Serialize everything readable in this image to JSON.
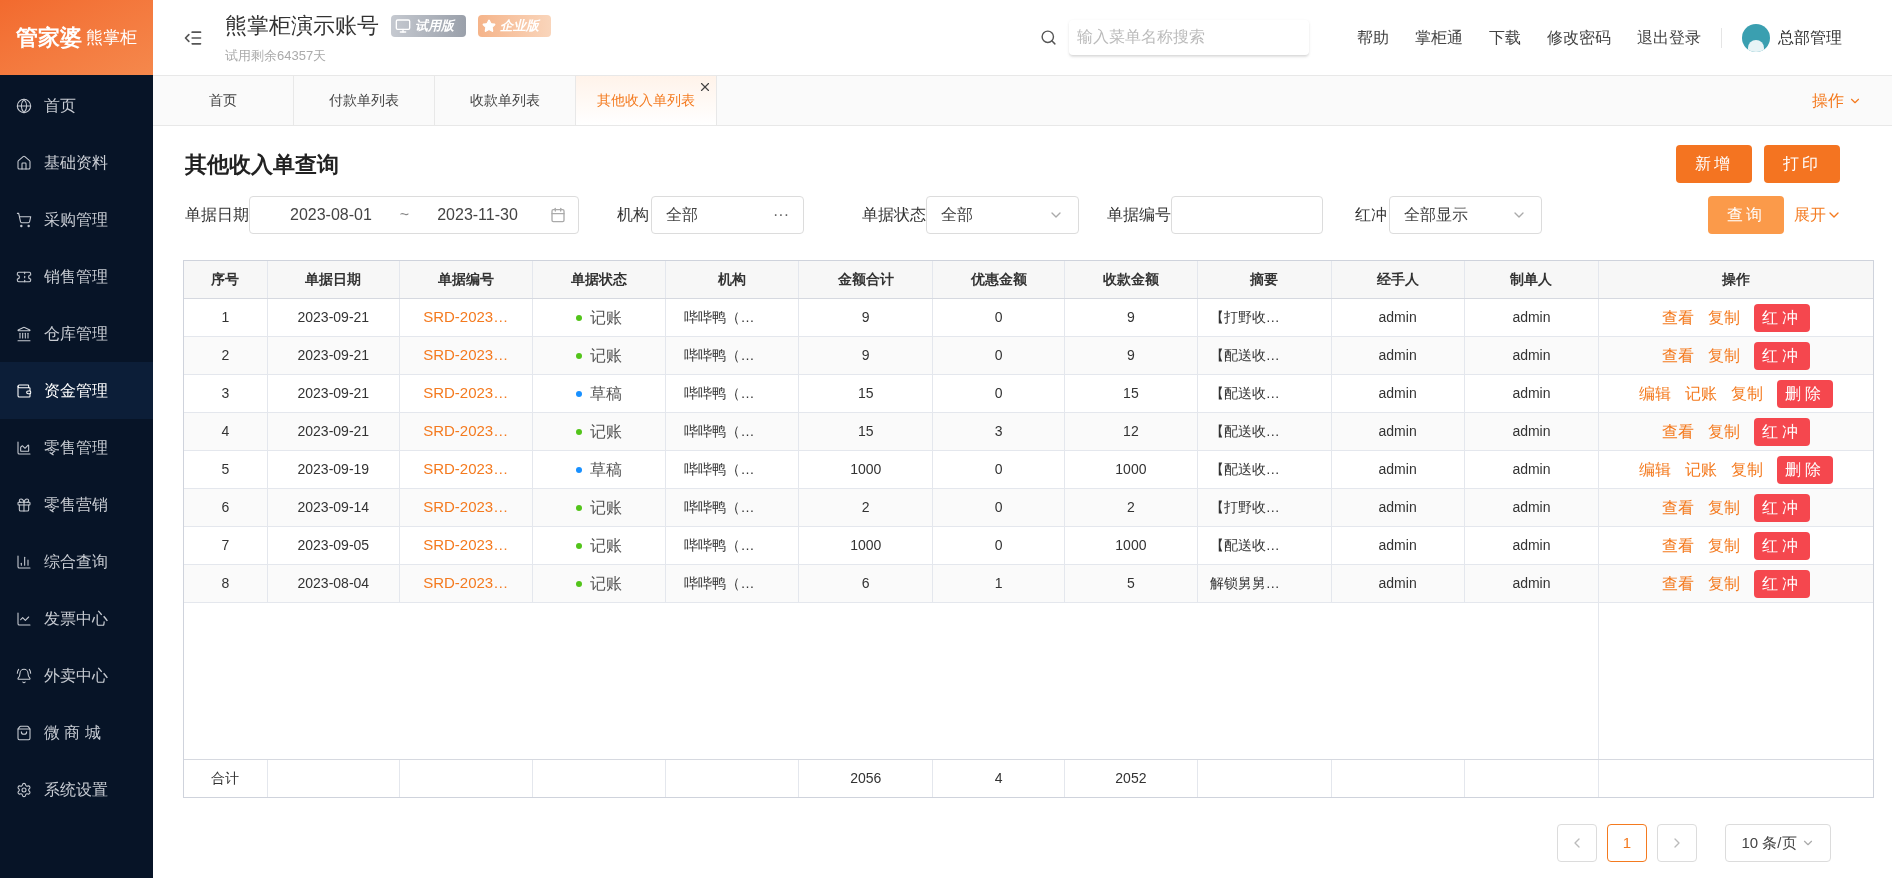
{
  "logo": {
    "brand": "管家婆",
    "product": "熊掌柜"
  },
  "sidebar": {
    "items": [
      {
        "label": "首页",
        "selected": false
      },
      {
        "label": "基础资料",
        "selected": false
      },
      {
        "label": "采购管理",
        "selected": false
      },
      {
        "label": "销售管理",
        "selected": false
      },
      {
        "label": "仓库管理",
        "selected": false
      },
      {
        "label": "资金管理",
        "selected": true
      },
      {
        "label": "零售管理",
        "selected": false
      },
      {
        "label": "零售营销",
        "selected": false
      },
      {
        "label": "综合查询",
        "selected": false
      },
      {
        "label": "发票中心",
        "selected": false
      },
      {
        "label": "外卖中心",
        "selected": false
      },
      {
        "label": "微 商 城",
        "selected": false
      },
      {
        "label": "系统设置",
        "selected": false
      }
    ]
  },
  "header": {
    "account": "熊掌柜演示账号",
    "badges": [
      {
        "kind": "trial",
        "label": "试用版"
      },
      {
        "kind": "enterprise",
        "label": "企业版"
      }
    ],
    "trial_note": "试用剩余64357天",
    "search": {
      "placeholder": "输入菜单名称搜索"
    },
    "links": [
      "帮助",
      "掌柜通",
      "下载",
      "修改密码",
      "退出登录"
    ],
    "user": "总部管理"
  },
  "tabs": [
    {
      "label": "首页",
      "selected": false,
      "closable": false
    },
    {
      "label": "付款单列表",
      "selected": false,
      "closable": false
    },
    {
      "label": "收款单列表",
      "selected": false,
      "closable": false
    },
    {
      "label": "其他收入单列表",
      "selected": true,
      "closable": true
    }
  ],
  "tab_menu": "操作",
  "page": {
    "title": "其他收入单查询",
    "buttons": [
      "新增",
      "打印"
    ]
  },
  "filters": {
    "date_label": "单据日期",
    "date_from": "2023-08-01",
    "date_sep": "~",
    "date_to": "2023-11-30",
    "org_label": "机构",
    "org_value": "全部",
    "org_more": "···",
    "status_label": "单据状态",
    "status_value": "全部",
    "number_label": "单据编号",
    "red_label": "红冲",
    "red_value": "全部显示",
    "query": "查询",
    "expand": "展开"
  },
  "table": {
    "columns": [
      "序号",
      "单据日期",
      "单据编号",
      "单据状态",
      "机构",
      "金额合计",
      "优惠金额",
      "收款金额",
      "摘要",
      "经手人",
      "制单人",
      "操作"
    ],
    "rows": [
      {
        "no": "1",
        "date": "2023-09-21",
        "number": "SRD-2023…",
        "status": "记账",
        "color": "#52c41a",
        "org": "哔哔鸭（…",
        "total": "9",
        "discount": "0",
        "received": "9",
        "summary": "【打野收…",
        "handler": "admin",
        "maker": "admin",
        "actions": [
          {
            "kind": "link",
            "label": "查看"
          },
          {
            "kind": "link",
            "label": "复制"
          },
          {
            "kind": "danger",
            "label": "红冲"
          }
        ]
      },
      {
        "no": "2",
        "date": "2023-09-21",
        "number": "SRD-2023…",
        "status": "记账",
        "color": "#52c41a",
        "org": "哔哔鸭（…",
        "total": "9",
        "discount": "0",
        "received": "9",
        "summary": "【配送收…",
        "handler": "admin",
        "maker": "admin",
        "actions": [
          {
            "kind": "link",
            "label": "查看"
          },
          {
            "kind": "link",
            "label": "复制"
          },
          {
            "kind": "danger",
            "label": "红冲"
          }
        ]
      },
      {
        "no": "3",
        "date": "2023-09-21",
        "number": "SRD-2023…",
        "status": "草稿",
        "color": "#1890ff",
        "org": "哔哔鸭（…",
        "total": "15",
        "discount": "0",
        "received": "15",
        "summary": "【配送收…",
        "handler": "admin",
        "maker": "admin",
        "actions": [
          {
            "kind": "link",
            "label": "编辑"
          },
          {
            "kind": "link",
            "label": "记账"
          },
          {
            "kind": "link",
            "label": "复制"
          },
          {
            "kind": "danger",
            "label": "删除"
          }
        ]
      },
      {
        "no": "4",
        "date": "2023-09-21",
        "number": "SRD-2023…",
        "status": "记账",
        "color": "#52c41a",
        "org": "哔哔鸭（…",
        "total": "15",
        "discount": "3",
        "received": "12",
        "summary": "【配送收…",
        "handler": "admin",
        "maker": "admin",
        "actions": [
          {
            "kind": "link",
            "label": "查看"
          },
          {
            "kind": "link",
            "label": "复制"
          },
          {
            "kind": "danger",
            "label": "红冲"
          }
        ]
      },
      {
        "no": "5",
        "date": "2023-09-19",
        "number": "SRD-2023…",
        "status": "草稿",
        "color": "#1890ff",
        "org": "哔哔鸭（…",
        "total": "1000",
        "discount": "0",
        "received": "1000",
        "summary": "【配送收…",
        "handler": "admin",
        "maker": "admin",
        "actions": [
          {
            "kind": "link",
            "label": "编辑"
          },
          {
            "kind": "link",
            "label": "记账"
          },
          {
            "kind": "link",
            "label": "复制"
          },
          {
            "kind": "danger",
            "label": "删除"
          }
        ]
      },
      {
        "no": "6",
        "date": "2023-09-14",
        "number": "SRD-2023…",
        "status": "记账",
        "color": "#52c41a",
        "org": "哔哔鸭（…",
        "total": "2",
        "discount": "0",
        "received": "2",
        "summary": "【打野收…",
        "handler": "admin",
        "maker": "admin",
        "actions": [
          {
            "kind": "link",
            "label": "查看"
          },
          {
            "kind": "link",
            "label": "复制"
          },
          {
            "kind": "danger",
            "label": "红冲"
          }
        ]
      },
      {
        "no": "7",
        "date": "2023-09-05",
        "number": "SRD-2023…",
        "status": "记账",
        "color": "#52c41a",
        "org": "哔哔鸭（…",
        "total": "1000",
        "discount": "0",
        "received": "1000",
        "summary": "【配送收…",
        "handler": "admin",
        "maker": "admin",
        "actions": [
          {
            "kind": "link",
            "label": "查看"
          },
          {
            "kind": "link",
            "label": "复制"
          },
          {
            "kind": "danger",
            "label": "红冲"
          }
        ]
      },
      {
        "no": "8",
        "date": "2023-08-04",
        "number": "SRD-2023…",
        "status": "记账",
        "color": "#52c41a",
        "org": "哔哔鸭（…",
        "total": "6",
        "discount": "1",
        "received": "5",
        "summary": "解锁舅舅…",
        "handler": "admin",
        "maker": "admin",
        "actions": [
          {
            "kind": "link",
            "label": "查看"
          },
          {
            "kind": "link",
            "label": "复制"
          },
          {
            "kind": "danger",
            "label": "红冲"
          }
        ]
      }
    ],
    "footer": {
      "label": "合计",
      "total": "2056",
      "discount": "4",
      "received": "2052"
    }
  },
  "pagination": {
    "pages": [
      {
        "label": "1",
        "selected": true
      }
    ],
    "page_size": "10 条/页"
  }
}
